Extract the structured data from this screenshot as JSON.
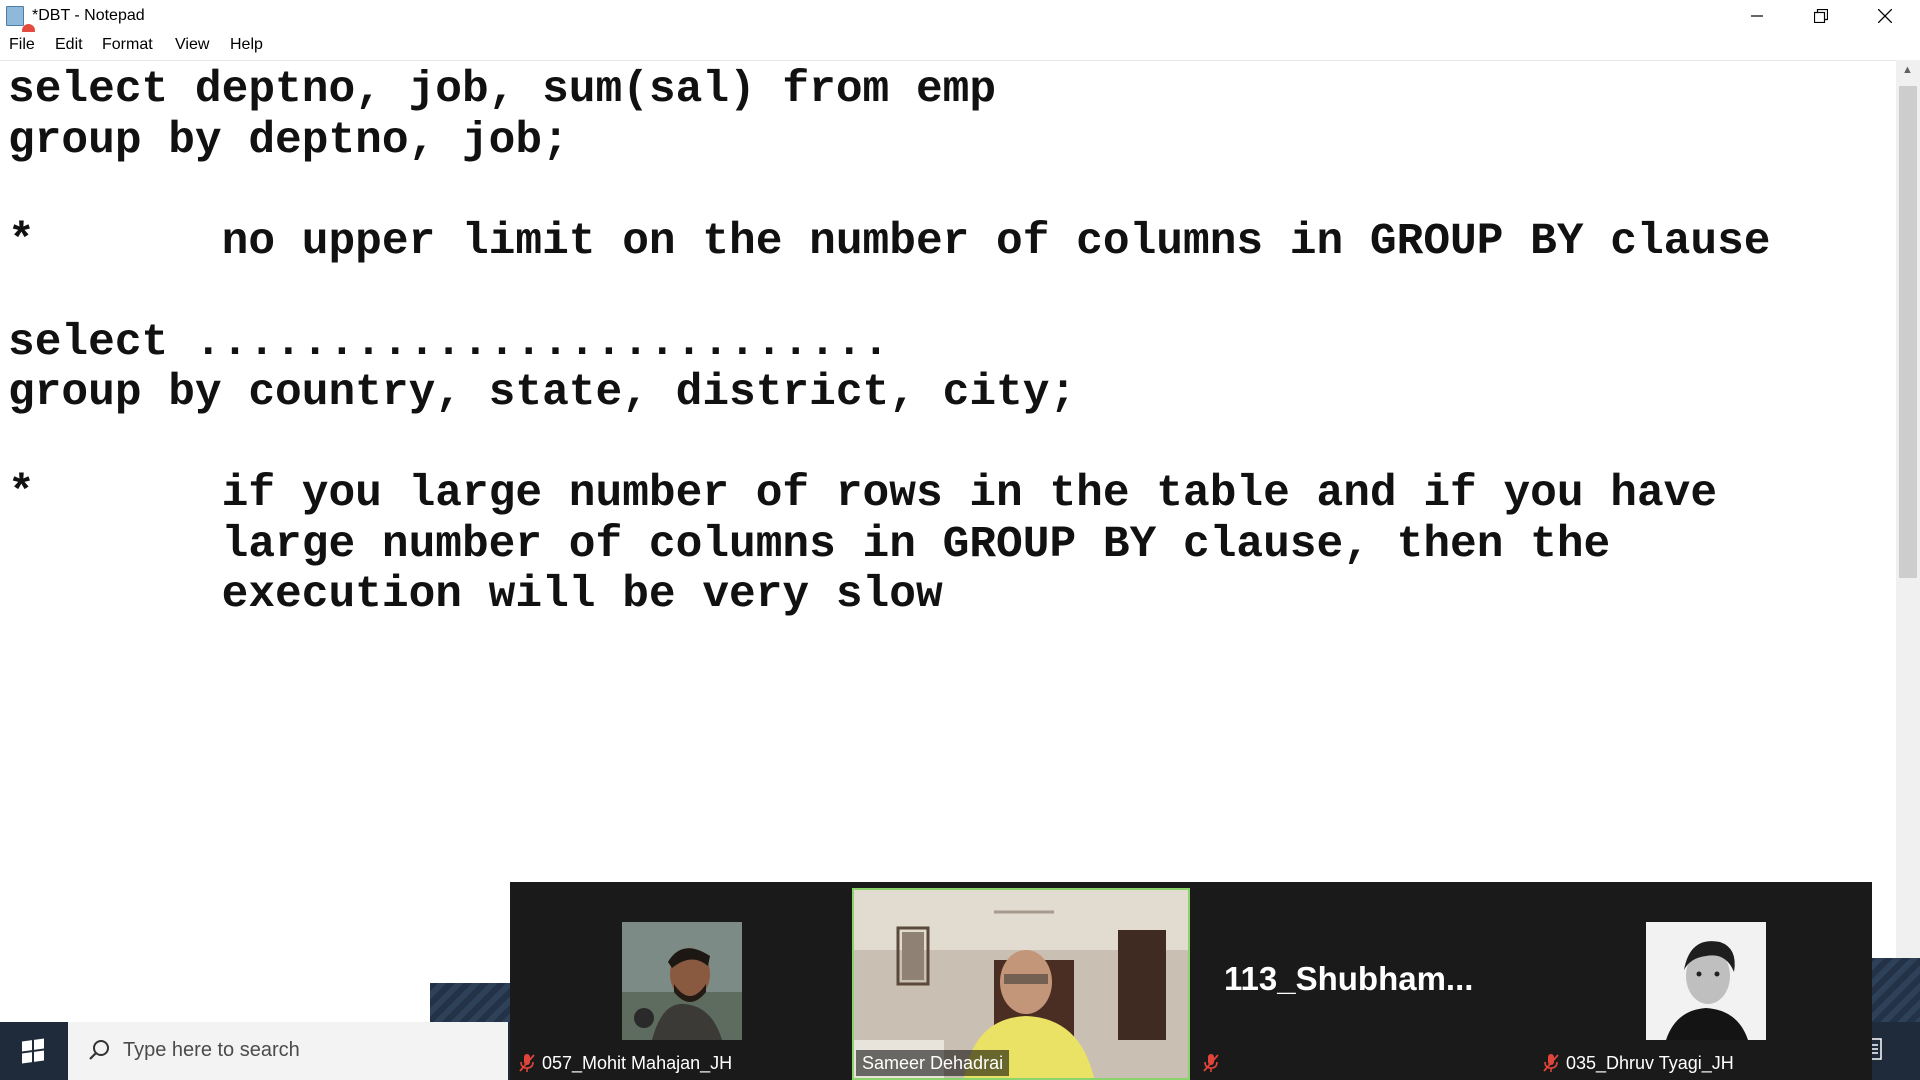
{
  "window": {
    "title": "*DBT - Notepad"
  },
  "menu": {
    "items": [
      "File",
      "Edit",
      "Format",
      "View",
      "Help"
    ]
  },
  "editor": {
    "content": "select deptno, job, sum(sal) from emp\ngroup by deptno, job;\n\n*       no upper limit on the number of columns in GROUP BY clause\n\nselect ..........................\ngroup by country, state, district, city;\n\n*       if you large number of rows in the table and if you have\n        large number of columns in GROUP BY clause, then the\n        execution will be very slow"
  },
  "taskbar": {
    "search_placeholder": "Type here to search"
  },
  "meeting": {
    "participants": [
      {
        "name": "057_Mohit Mahajan_JH",
        "muted": true,
        "video": true,
        "active": false
      },
      {
        "name": "Sameer Dehadrai",
        "muted": false,
        "video": true,
        "active": true
      },
      {
        "name": "113_Shubham...",
        "muted": true,
        "video": false,
        "active": false
      },
      {
        "name": "035_Dhruv Tyagi_JH",
        "muted": true,
        "video": true,
        "active": false
      }
    ]
  },
  "colors": {
    "active_speaker_border": "#8bd36b",
    "taskbar": "#1f2b3a",
    "video_strip": "#1a1a1a",
    "muted_icon": "#e0443a"
  }
}
